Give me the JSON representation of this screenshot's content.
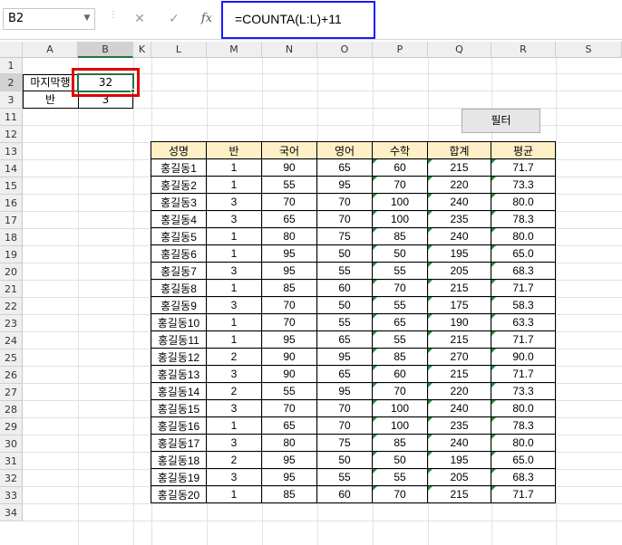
{
  "formula_bar": {
    "name_box": "B2",
    "cancel_icon": "✕",
    "enter_icon": "✓",
    "fx_label": "fx",
    "formula": "=COUNTA(L:L)+11"
  },
  "columns": [
    "A",
    "B",
    "K",
    "L",
    "M",
    "N",
    "O",
    "P",
    "Q",
    "R",
    "S"
  ],
  "rows": [
    "1",
    "2",
    "3",
    "11",
    "12",
    "13",
    "14",
    "15",
    "16",
    "17",
    "18",
    "19",
    "20",
    "21",
    "22",
    "23",
    "24",
    "25",
    "26",
    "27",
    "28",
    "29",
    "30",
    "31",
    "32",
    "33",
    "34"
  ],
  "cells": {
    "A2": "마지막행",
    "B2": "32",
    "A3": "반",
    "B3": "3"
  },
  "button": {
    "label": "필터"
  },
  "table": {
    "headers": [
      "성명",
      "반",
      "국어",
      "영어",
      "수학",
      "합계",
      "평균"
    ],
    "rows": [
      [
        "홍길동1",
        "1",
        "90",
        "65",
        "60",
        "215",
        "71.7"
      ],
      [
        "홍길동2",
        "1",
        "55",
        "95",
        "70",
        "220",
        "73.3"
      ],
      [
        "홍길동3",
        "3",
        "70",
        "70",
        "100",
        "240",
        "80.0"
      ],
      [
        "홍길동4",
        "3",
        "65",
        "70",
        "100",
        "235",
        "78.3"
      ],
      [
        "홍길동5",
        "1",
        "80",
        "75",
        "85",
        "240",
        "80.0"
      ],
      [
        "홍길동6",
        "1",
        "95",
        "50",
        "50",
        "195",
        "65.0"
      ],
      [
        "홍길동7",
        "3",
        "95",
        "55",
        "55",
        "205",
        "68.3"
      ],
      [
        "홍길동8",
        "1",
        "85",
        "60",
        "70",
        "215",
        "71.7"
      ],
      [
        "홍길동9",
        "3",
        "70",
        "50",
        "55",
        "175",
        "58.3"
      ],
      [
        "홍길동10",
        "1",
        "70",
        "55",
        "65",
        "190",
        "63.3"
      ],
      [
        "홍길동11",
        "1",
        "95",
        "65",
        "55",
        "215",
        "71.7"
      ],
      [
        "홍길동12",
        "2",
        "90",
        "95",
        "85",
        "270",
        "90.0"
      ],
      [
        "홍길동13",
        "3",
        "90",
        "65",
        "60",
        "215",
        "71.7"
      ],
      [
        "홍길동14",
        "2",
        "55",
        "95",
        "70",
        "220",
        "73.3"
      ],
      [
        "홍길동15",
        "3",
        "70",
        "70",
        "100",
        "240",
        "80.0"
      ],
      [
        "홍길동16",
        "1",
        "65",
        "70",
        "100",
        "235",
        "78.3"
      ],
      [
        "홍길동17",
        "3",
        "80",
        "75",
        "85",
        "240",
        "80.0"
      ],
      [
        "홍길동18",
        "2",
        "95",
        "50",
        "50",
        "195",
        "65.0"
      ],
      [
        "홍길동19",
        "3",
        "95",
        "55",
        "55",
        "205",
        "68.3"
      ],
      [
        "홍길동20",
        "1",
        "85",
        "60",
        "70",
        "215",
        "71.7"
      ]
    ]
  },
  "colors": {
    "formula_highlight": "#1a1aff",
    "cell_highlight": "#e00000",
    "selection": "#217346",
    "table_header_bg": "#ffefc6"
  }
}
